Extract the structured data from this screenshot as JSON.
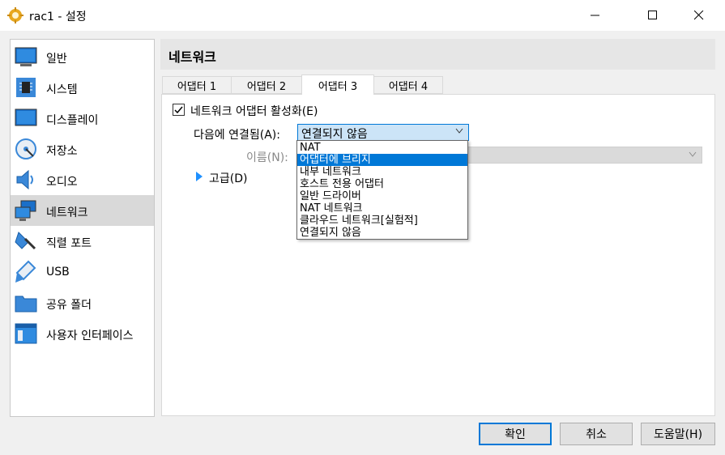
{
  "window": {
    "title": "rac1 - 설정",
    "gear_icon": "gear-icon",
    "minimize_icon": "minimize-icon",
    "maximize_icon": "maximize-icon",
    "close_icon": "close-icon"
  },
  "sidebar": {
    "items": [
      {
        "label": "일반",
        "icon": "general-icon"
      },
      {
        "label": "시스템",
        "icon": "chip-icon"
      },
      {
        "label": "디스플레이",
        "icon": "monitor-icon"
      },
      {
        "label": "저장소",
        "icon": "disk-icon"
      },
      {
        "label": "오디오",
        "icon": "speaker-icon"
      },
      {
        "label": "네트워크",
        "icon": "network-icon",
        "selected": true
      },
      {
        "label": "직렬 포트",
        "icon": "serial-port-icon"
      },
      {
        "label": "USB",
        "icon": "usb-icon"
      },
      {
        "label": "공유 폴더",
        "icon": "folder-icon"
      },
      {
        "label": "사용자 인터페이스",
        "icon": "ui-icon"
      }
    ]
  },
  "page": {
    "title": "네트워크",
    "tabs": [
      {
        "label": "어댑터 1"
      },
      {
        "label": "어댑터 2"
      },
      {
        "label": "어댑터 3",
        "active": true
      },
      {
        "label": "어댑터 4"
      }
    ],
    "enable_adapter": {
      "label": "네트워크 어댑터 활성화(E)",
      "checked": true
    },
    "attached_to": {
      "label": "다음에 연결됨(A):",
      "value": "연결되지 않음",
      "options": [
        "NAT",
        "어댑터에 브리지",
        "내부 네트워크",
        "호스트 전용 어댑터",
        "일반 드라이버",
        "NAT 네트워크",
        "클라우드 네트워크[실험적]",
        "연결되지 않음"
      ],
      "highlighted": "어댑터에 브리지"
    },
    "name": {
      "label": "이름(N):",
      "value": ""
    },
    "advanced": {
      "label": "고급(D)"
    }
  },
  "buttons": {
    "ok": "확인",
    "cancel": "취소",
    "help": "도움말(H)"
  },
  "colors": {
    "accent": "#0078d7",
    "selection": "#d9d9d9",
    "combo_bg": "#cce4f7"
  }
}
